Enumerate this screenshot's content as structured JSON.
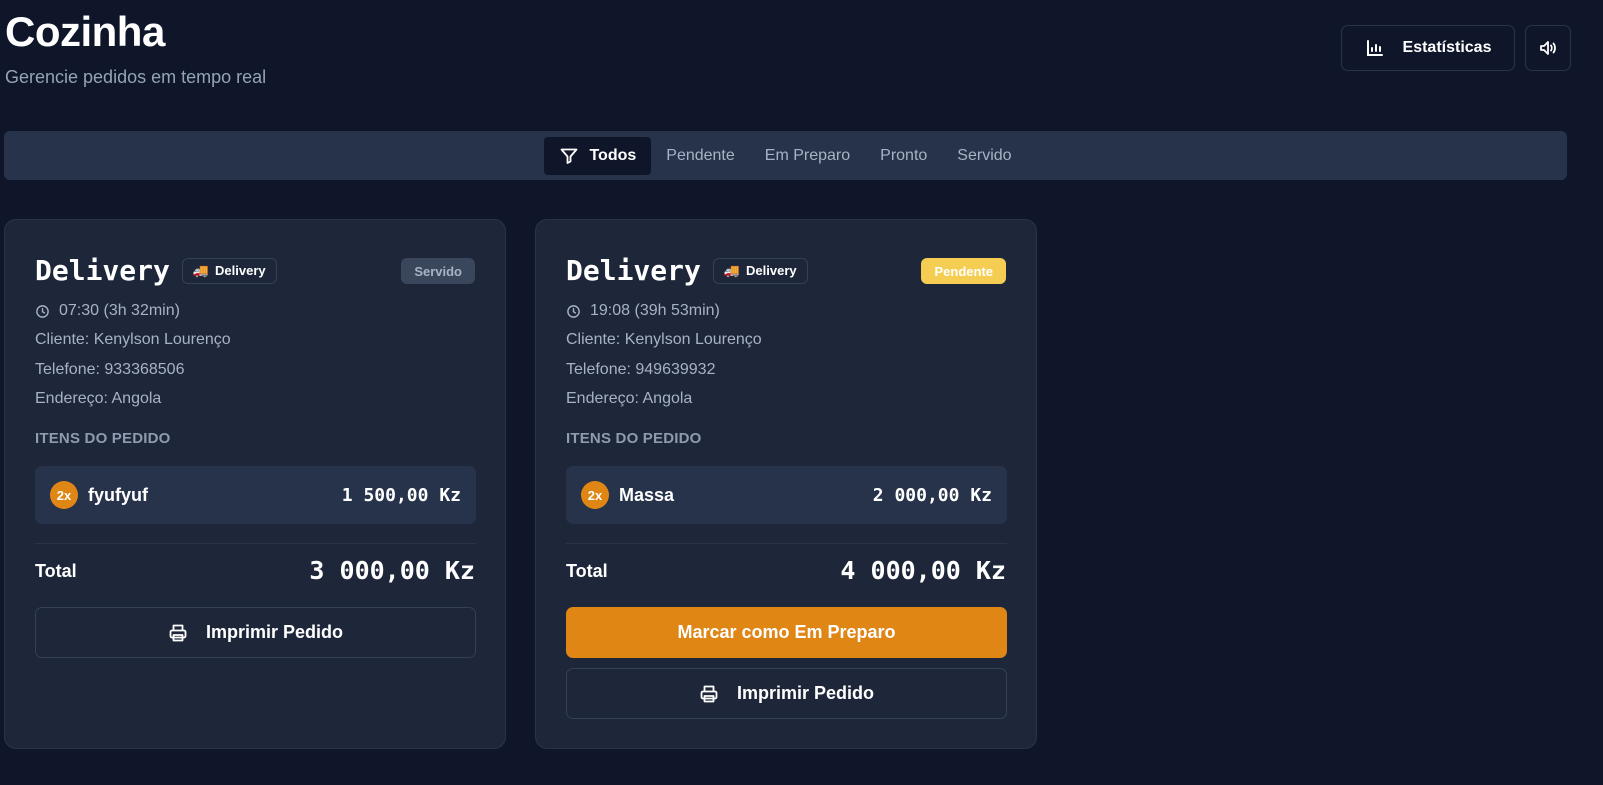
{
  "header": {
    "title": "Cozinha",
    "subtitle": "Gerencie pedidos em tempo real",
    "stats_label": "Estatísticas",
    "stats_icon": "bar-chart-icon",
    "sound_icon": "volume-icon"
  },
  "filters": {
    "icon": "filter-icon",
    "tabs": [
      {
        "label": "Todos",
        "active": true
      },
      {
        "label": "Pendente",
        "active": false
      },
      {
        "label": "Em Preparo",
        "active": false
      },
      {
        "label": "Pronto",
        "active": false
      },
      {
        "label": "Servido",
        "active": false
      }
    ]
  },
  "orders": [
    {
      "title": "Delivery",
      "type_badge": "Delivery",
      "type_icon": "🚚",
      "status": "Servido",
      "status_color": "#3a465b",
      "time": "07:30 (3h 32min)",
      "client": "Cliente: Kenylson Lourenço",
      "phone": "Telefone: 933368506",
      "address": "Endereço: Angola",
      "items_label": "ITENS DO PEDIDO",
      "items": [
        {
          "qty": "2x",
          "name": "fyufyuf",
          "price": "1 500,00 Kz"
        }
      ],
      "total_label": "Total",
      "total": "3 000,00 Kz",
      "print_label": "Imprimir Pedido"
    },
    {
      "title": "Delivery",
      "type_badge": "Delivery",
      "type_icon": "🚚",
      "status": "Pendente",
      "status_color": "#f5cd52",
      "time": "19:08 (39h 53min)",
      "client": "Cliente: Kenylson Lourenço",
      "phone": "Telefone: 949639932",
      "address": "Endereço: Angola",
      "items_label": "ITENS DO PEDIDO",
      "items": [
        {
          "qty": "2x",
          "name": "Massa",
          "price": "2 000,00 Kz"
        }
      ],
      "total_label": "Total",
      "total": "4 000,00 Kz",
      "action_label": "Marcar como Em Preparo",
      "print_label": "Imprimir Pedido"
    }
  ],
  "colors": {
    "background": "#0f1629",
    "card": "#1e2739",
    "accent": "#e08615",
    "pending": "#f5cd52"
  }
}
